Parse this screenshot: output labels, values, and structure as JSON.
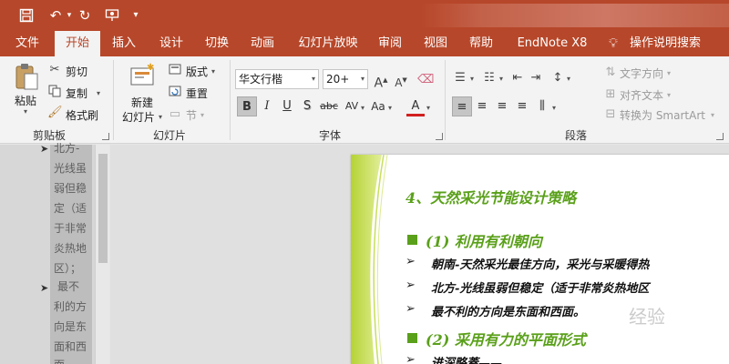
{
  "qat": {
    "save_icon": "save-icon",
    "undo_icon": "undo-icon",
    "redo_icon": "repeat-icon",
    "present_icon": "present-from-start-icon",
    "customize_icon": "chevron-down-icon"
  },
  "tabs": [
    "文件",
    "开始",
    "插入",
    "设计",
    "切换",
    "动画",
    "幻灯片放映",
    "审阅",
    "视图",
    "帮助",
    "EndNote X8",
    "操作说明搜索"
  ],
  "active_tab": "开始",
  "colors": {
    "accent": "#b7472a",
    "ribbon": "#f3f3f3",
    "slide_green": "#5aa01a"
  },
  "ribbon": {
    "clipboard": {
      "paste": "粘贴",
      "cut": "剪切",
      "copy": "复制",
      "format_painter": "格式刷",
      "label": "剪贴板"
    },
    "slides": {
      "new_slide": "新建",
      "new_slide_2": "幻灯片",
      "layout": "版式",
      "reset": "重置",
      "section": "节",
      "label": "幻灯片"
    },
    "font": {
      "font_name": "华文行楷",
      "font_size": "20+",
      "bold": "B",
      "italic": "I",
      "underline": "U",
      "shadow": "S",
      "strikethrough": "abc",
      "spacing": "AV",
      "case": "Aa",
      "font_color": "A",
      "grow": "A",
      "shrink": "A",
      "label": "字体"
    },
    "paragraph": {
      "text_direction": "文字方向",
      "align_text": "对齐文本",
      "convert_smartart": "转换为 SmartArt",
      "label": "段落"
    }
  },
  "outline": {
    "lines_a": [
      "北方-",
      "光线虽",
      "弱但稳",
      "定（适",
      "于非常",
      "炎热地",
      "区）；"
    ],
    "lines_b": [
      "最不",
      "利的方",
      "向是东",
      "面和西",
      "面"
    ]
  },
  "slide": {
    "title": "4、天然采光节能设计策略",
    "h2_1": "(1) 利用有利朝向",
    "bullets_1": [
      "朝南-天然采光最佳方向，采光与采暖得热",
      "北方-光线虽弱但稳定（适于非常炎热地区",
      "最不利的方向是东面和西面。"
    ],
    "h2_2": "(2) 采用有力的平面形式",
    "bullet_partial": "进深略蓋——"
  },
  "watermark": "经验"
}
